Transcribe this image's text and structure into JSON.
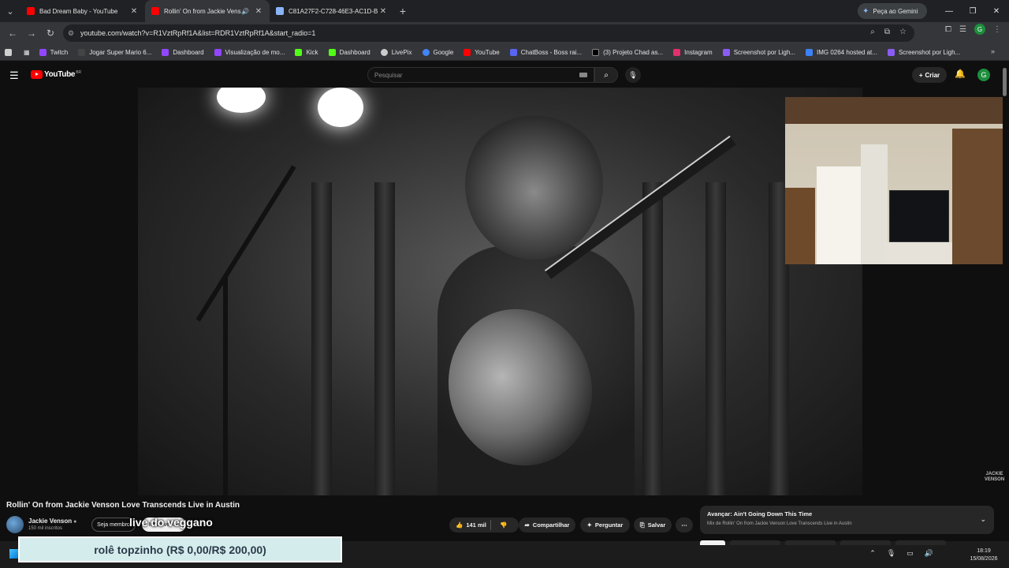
{
  "browser": {
    "tabs": [
      {
        "title": "Bad Dream Baby - YouTube",
        "active": false,
        "icon": "youtube-icon"
      },
      {
        "title": "Rollin' On from Jackie Venso",
        "active": true,
        "icon": "youtube-icon",
        "audio": true
      },
      {
        "title": "C81A27F2-C728-46E3-AC1D-B",
        "active": false,
        "icon": "image-icon"
      }
    ],
    "gemini_label": "Peça ao Gemini",
    "url": "youtube.com/watch?v=R1VztRpRf1A&list=RDR1VztRpRf1A&start_radio=1",
    "profile_initial": "G",
    "bookmarks": [
      {
        "label": "Twitch",
        "color": "#9146ff"
      },
      {
        "label": "Jogar Super Mario 6...",
        "color": "#444444"
      },
      {
        "label": "Dashboard",
        "color": "#9146ff"
      },
      {
        "label": "Visualização de mo...",
        "color": "#9146ff"
      },
      {
        "label": "Kick",
        "color": "#53fc18"
      },
      {
        "label": "Dashboard",
        "color": "#53fc18"
      },
      {
        "label": "LivePix",
        "color": "#cccccc"
      },
      {
        "label": "Google",
        "color": "#4285f4"
      },
      {
        "label": "YouTube",
        "color": "#ff0000"
      },
      {
        "label": "ChatBoss - Boss rai...",
        "color": "#5865f2"
      },
      {
        "label": "(3) Projeto Chad as...",
        "color": "#000000"
      },
      {
        "label": "Instagram",
        "color": "#e1306c"
      },
      {
        "label": "Screenshot por Ligh...",
        "color": "#8a5cf6"
      },
      {
        "label": "IMG 0264 hosted at...",
        "color": "#3b82f6"
      },
      {
        "label": "Screenshot por Ligh...",
        "color": "#8a5cf6"
      }
    ]
  },
  "youtube": {
    "logo_text": "YouTube",
    "logo_region": "BR",
    "search_placeholder": "Pesquisar",
    "create_label": "Criar",
    "avatar_initial": "G",
    "video_title": "Rollin' On from Jackie Venson Love Transcends Live in Austin",
    "channel_name": "Jackie Venson",
    "subscribers": "150 mil inscritos",
    "join_label": "Seja membro",
    "subscribe_label": "Inscrever-se",
    "overlay_text": "live do veggano",
    "watermark": "JACKIE VENSON",
    "actions": {
      "likes": "141 mil",
      "share": "Compartilhar",
      "ask": "Perguntar",
      "save": "Salvar",
      "more": "⋯"
    },
    "up_next": {
      "title": "Avançar: Ain't Going Down This Time",
      "subtitle": "Mix de Rollin' On from Jackie Venson Love Transcends Live in Austin"
    }
  },
  "donation_goal": "rolê topzinho (R$ 0,00/R$ 200,00)",
  "taskbar": {
    "time": "18:19",
    "date": "15/08/2026"
  }
}
